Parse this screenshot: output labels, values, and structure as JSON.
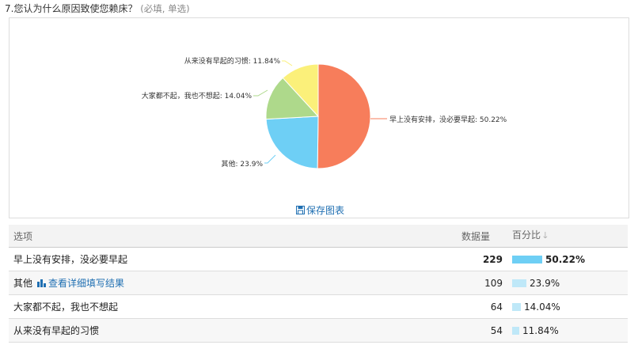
{
  "question": {
    "title": "7.您认为什么原因致使您赖床？",
    "hint": "(必填, 单选)"
  },
  "chart_data": {
    "type": "pie",
    "categories": [
      "早上没有安排，没必要早起",
      "其他",
      "大家都不起，我也不想起",
      "从来没有早起的习惯"
    ],
    "values": [
      50.22,
      23.9,
      14.04,
      11.84
    ],
    "colors": [
      "#f77d5b",
      "#6ecff5",
      "#aed98b",
      "#fbf07a"
    ],
    "labels": [
      "早上没有安排，没必要早起: 50.22%",
      "其他: 23.9%",
      "大家都不起，我也不想起: 14.04%",
      "从来没有早起的习惯: 11.84%"
    ]
  },
  "save_chart_label": "保存图表",
  "table": {
    "headers": {
      "option": "选项",
      "count": "数据量",
      "percent": "百分比"
    },
    "rows": [
      {
        "option": "早上没有安排，没必要早起",
        "count": "229",
        "percent": "50.22%",
        "fraction": 0.5022,
        "bar_color": "#6ecff5",
        "bold": true,
        "link": ""
      },
      {
        "option": "其他",
        "count": "109",
        "percent": "23.9%",
        "fraction": 0.239,
        "bar_color": "#bfe8f8",
        "bold": false,
        "link": "查看详细填写结果"
      },
      {
        "option": "大家都不起，我也不想起",
        "count": "64",
        "percent": "14.04%",
        "fraction": 0.1404,
        "bar_color": "#bfe8f8",
        "bold": false,
        "link": ""
      },
      {
        "option": "从来没有早起的习惯",
        "count": "54",
        "percent": "11.84%",
        "fraction": 0.1184,
        "bar_color": "#bfe8f8",
        "bold": false,
        "link": ""
      }
    ]
  },
  "icons": {
    "save": "floppy-disk-icon",
    "detail": "bar-chart-icon",
    "sort": "arrow-down-icon"
  }
}
